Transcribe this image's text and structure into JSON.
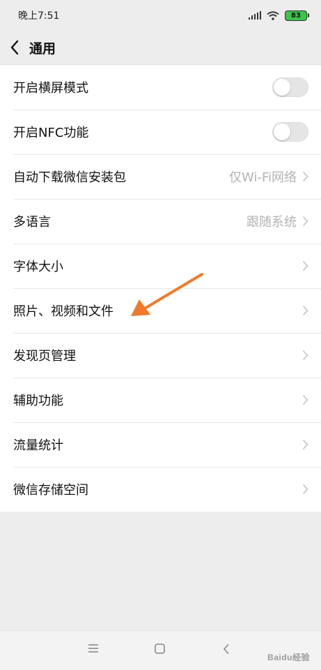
{
  "status_bar": {
    "time": "晚上7:51",
    "battery_level": "83"
  },
  "header": {
    "title": "通用"
  },
  "settings": [
    {
      "label": "开启横屏模式",
      "type": "toggle",
      "on": false
    },
    {
      "label": "开启NFC功能",
      "type": "toggle",
      "on": false
    },
    {
      "label": "自动下载微信安装包",
      "type": "value",
      "value": "仅Wi-Fi网络"
    },
    {
      "label": "多语言",
      "type": "value",
      "value": "跟随系统"
    },
    {
      "label": "字体大小",
      "type": "link"
    },
    {
      "label": "照片、视频和文件",
      "type": "link"
    },
    {
      "label": "发现页管理",
      "type": "link"
    },
    {
      "label": "辅助功能",
      "type": "link"
    },
    {
      "label": "流量统计",
      "type": "link"
    },
    {
      "label": "微信存储空间",
      "type": "link"
    }
  ],
  "watermark": "Baidu经验",
  "colors": {
    "annotation_arrow": "#f07a2b",
    "battery": "#3cc34a",
    "toggle_off": "#e5e5e5"
  }
}
